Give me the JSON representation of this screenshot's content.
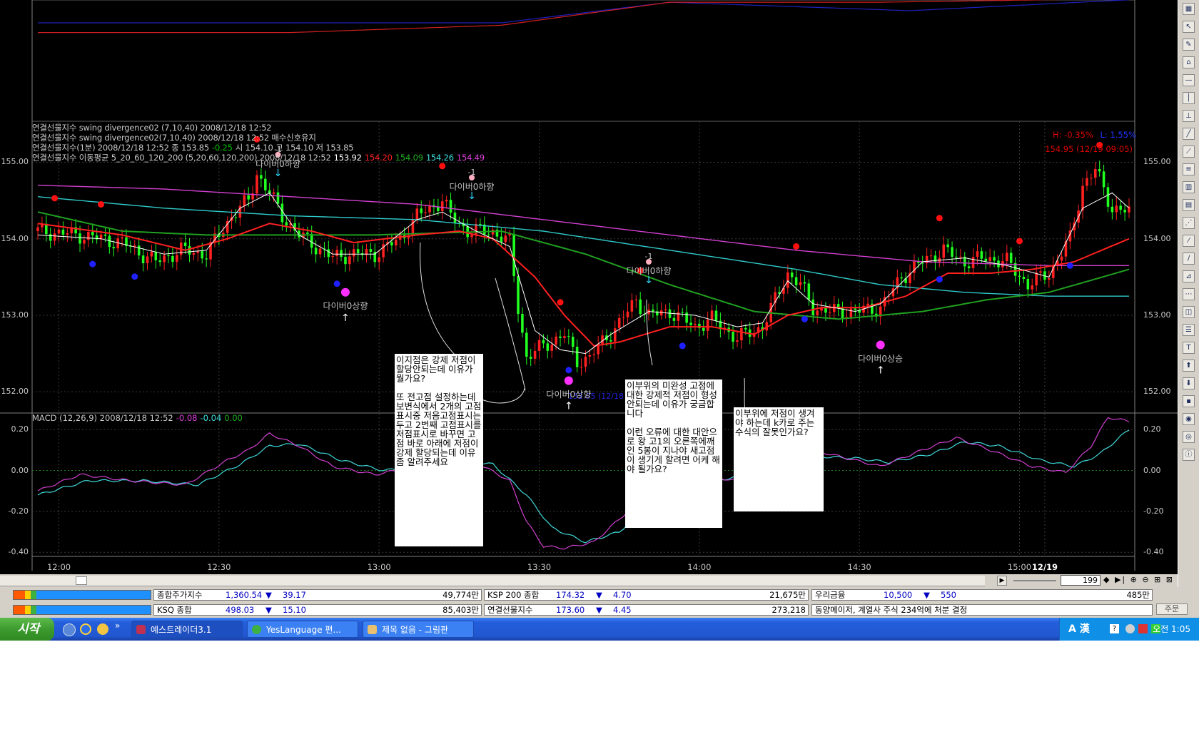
{
  "info_lines": [
    [
      {
        "text": "연결선물지수 swing divergence02  (7,10,40) 2008/12/18 12:52",
        "color": "#c8c8c8"
      }
    ],
    [
      {
        "text": "연결선물지수 swing divergence02(7,10,40)  2008/12/18 12:52  매수신호유지",
        "color": "#c8c8c8"
      }
    ],
    [
      {
        "text": "연결선물지수(1분) 2008/12/18 12:52  종 153.85",
        "color": "#c8c8c8"
      },
      {
        "text": "-0.25",
        "color": "#00c000"
      },
      {
        "text": "시 154.10 고 154.10 저 153.85",
        "color": "#c8c8c8"
      }
    ],
    [
      {
        "text": "연결선물지수 이동평균 5_20_60_120_200  (5,20,60,120,200) 2008/12/18 12:52",
        "color": "#c8c8c8"
      },
      {
        "text": "153.92",
        "color": "#ffffff"
      },
      {
        "text": "154.20",
        "color": "#ff2020"
      },
      {
        "text": "154.09",
        "color": "#20b020"
      },
      {
        "text": "154.26",
        "color": "#40e0e0"
      },
      {
        "text": "154.49",
        "color": "#e040e0"
      }
    ]
  ],
  "hl_line": {
    "h": "H: -0.35%",
    "l": "L: 1.55%"
  },
  "max_label": "154.95 (12/19 09:05)",
  "min_label": "152.05 (12/18",
  "y_labels": [
    "155.00",
    "154.00",
    "153.00",
    "152.00"
  ],
  "macd_y_labels": [
    "0.20",
    "0.00",
    "-0.20",
    "-0.40"
  ],
  "x_labels": [
    "12:00",
    "12:30",
    "13:00",
    "13:30",
    "14:00",
    "14:30",
    "15:00",
    "12/19"
  ],
  "macd_legend": [
    {
      "text": "MACD  (12,26,9) 2008/12/18 12:52",
      "color": "#c8c8c8"
    },
    {
      "text": "-0.08",
      "color": "#e040e0"
    },
    {
      "text": "-0.04",
      "color": "#40e0e0"
    },
    {
      "text": "0.00",
      "color": "#20b020"
    }
  ],
  "signals": [
    {
      "label": "다이버0하향",
      "minus": "-1",
      "t": 57
    },
    {
      "label": "다이버0상향",
      "minus": "",
      "t": 73
    },
    {
      "label": "다이버0하향",
      "minus": "-1",
      "t": 103
    },
    {
      "label": "다이버0상향",
      "minus": "",
      "t": 126
    },
    {
      "label": "다이버0하향",
      "minus": "-1",
      "t": 145
    },
    {
      "label": "다이버0상승",
      "minus": "",
      "t": 200
    }
  ],
  "memos": [
    {
      "paragraphs": [
        "이지점은 강제 저점이 할당안되는데 이유가 뭘가요?",
        "또 전고점 설정하는데 보변식에서 2개의 고점표시중 저음고점표시는 두고 2번째 고점표시를 저점표시로 바꾸면 고점 바로 아래에 저점이 강제 할당되는데 이유좀 알려주세요"
      ]
    },
    {
      "paragraphs": [
        "이부위의 미완성 고점에 대한 강제적 저점이 형성안되는데 이유가 궁금합니다",
        "이런 오류에 대한 대안으로 왕 고1의 오른쪽에깨인 5봉이 지나야 새고점이 생기게 할려면 어케 해야 될가요?"
      ]
    },
    {
      "paragraphs": [
        "이부위에 저점이 생겨야 하는데 k카로 주는 수식의 잘못인가요?"
      ]
    }
  ],
  "zoom_value": "199",
  "ticker_rows": [
    [
      {
        "name": "종합주가지수",
        "value": "1,360.54",
        "dir": "▼",
        "change": "39.17",
        "extra": "49,774만",
        "cls": "dn"
      },
      {
        "name": "KSP 200 종합",
        "value": "174.32",
        "dir": "▼",
        "change": "4.70",
        "extra": "21,675만",
        "cls": "dn"
      },
      {
        "name": "우리금융",
        "value": "10,500",
        "dir": "▼",
        "change": "550",
        "extra": "485만",
        "cls": "dn"
      }
    ],
    [
      {
        "name": "KSQ 종합",
        "value": "498.03",
        "dir": "▼",
        "change": "15.10",
        "extra": "85,403만",
        "cls": "dn"
      },
      {
        "name": "연결선물지수",
        "value": "173.60",
        "dir": "▼",
        "change": "4.45",
        "extra": "273,218",
        "cls": "dn"
      },
      {
        "name": "동양메이저, 계열사 주식 234억에 처분 결정",
        "value": "",
        "dir": "",
        "change": "",
        "extra": "",
        "cls": ""
      }
    ]
  ],
  "ticker_btn": "주문",
  "taskbar": {
    "start": "시작",
    "tasks": [
      "예스트레이더3.1",
      "YesLanguage 편...",
      "제목 없음 - 그림판"
    ],
    "clock": "오전 1:05",
    "ime": "A 漢"
  },
  "chart_data": {
    "type": "candlestick",
    "ylim": [
      151.9,
      155.2
    ],
    "macd_ylim": [
      -0.42,
      0.26
    ],
    "n_bars": 260,
    "x_tick_index": [
      5,
      43,
      81,
      119,
      157,
      195,
      233,
      239
    ],
    "price_keypoints": [
      [
        0,
        154.1
      ],
      [
        10,
        154.05
      ],
      [
        20,
        153.95
      ],
      [
        28,
        153.7
      ],
      [
        34,
        153.85
      ],
      [
        40,
        153.8
      ],
      [
        46,
        154.3
      ],
      [
        50,
        154.5
      ],
      [
        52,
        154.85
      ],
      [
        55,
        154.6
      ],
      [
        58,
        154.3
      ],
      [
        62,
        154.05
      ],
      [
        66,
        153.9
      ],
      [
        70,
        153.75
      ],
      [
        74,
        153.8
      ],
      [
        80,
        153.8
      ],
      [
        86,
        154.0
      ],
      [
        90,
        154.3
      ],
      [
        96,
        154.5
      ],
      [
        98,
        154.3
      ],
      [
        102,
        154.1
      ],
      [
        108,
        154.1
      ],
      [
        112,
        153.95
      ],
      [
        114,
        153.1
      ],
      [
        116,
        152.45
      ],
      [
        120,
        152.6
      ],
      [
        125,
        152.75
      ],
      [
        128,
        152.4
      ],
      [
        131,
        152.45
      ],
      [
        134,
        152.65
      ],
      [
        138,
        152.9
      ],
      [
        142,
        153.2
      ],
      [
        145,
        153.0
      ],
      [
        150,
        153.05
      ],
      [
        156,
        152.85
      ],
      [
        160,
        152.95
      ],
      [
        166,
        152.7
      ],
      [
        172,
        152.85
      ],
      [
        175,
        153.2
      ],
      [
        178,
        153.55
      ],
      [
        181,
        153.4
      ],
      [
        184,
        153.1
      ],
      [
        188,
        153.05
      ],
      [
        194,
        153.05
      ],
      [
        200,
        153.1
      ],
      [
        205,
        153.5
      ],
      [
        210,
        153.7
      ],
      [
        215,
        153.85
      ],
      [
        220,
        153.7
      ],
      [
        225,
        153.75
      ],
      [
        230,
        153.7
      ],
      [
        235,
        153.4
      ],
      [
        240,
        153.55
      ],
      [
        245,
        154.0
      ],
      [
        248,
        154.7
      ],
      [
        251,
        154.9
      ],
      [
        255,
        154.4
      ],
      [
        259,
        154.35
      ]
    ],
    "ma_white": [
      [
        0,
        154.05
      ],
      [
        15,
        154.0
      ],
      [
        30,
        153.8
      ],
      [
        40,
        153.85
      ],
      [
        48,
        154.4
      ],
      [
        55,
        154.6
      ],
      [
        62,
        154.05
      ],
      [
        70,
        153.8
      ],
      [
        80,
        153.8
      ],
      [
        90,
        154.25
      ],
      [
        96,
        154.35
      ],
      [
        104,
        154.1
      ],
      [
        112,
        153.9
      ],
      [
        118,
        152.8
      ],
      [
        124,
        152.55
      ],
      [
        130,
        152.5
      ],
      [
        136,
        152.75
      ],
      [
        145,
        153.05
      ],
      [
        156,
        153.0
      ],
      [
        166,
        152.85
      ],
      [
        172,
        152.9
      ],
      [
        178,
        153.45
      ],
      [
        184,
        153.15
      ],
      [
        194,
        153.05
      ],
      [
        200,
        153.15
      ],
      [
        210,
        153.7
      ],
      [
        220,
        153.75
      ],
      [
        230,
        153.65
      ],
      [
        240,
        153.5
      ],
      [
        248,
        154.4
      ],
      [
        255,
        154.6
      ],
      [
        259,
        154.4
      ]
    ],
    "ma_red": [
      [
        0,
        154.2
      ],
      [
        20,
        154.05
      ],
      [
        35,
        153.85
      ],
      [
        45,
        154.0
      ],
      [
        55,
        154.2
      ],
      [
        65,
        154.1
      ],
      [
        75,
        153.95
      ],
      [
        90,
        154.05
      ],
      [
        100,
        154.1
      ],
      [
        108,
        154.0
      ],
      [
        118,
        153.5
      ],
      [
        125,
        153.0
      ],
      [
        132,
        152.6
      ],
      [
        138,
        152.65
      ],
      [
        150,
        152.85
      ],
      [
        160,
        152.85
      ],
      [
        170,
        152.75
      ],
      [
        178,
        153.0
      ],
      [
        186,
        153.1
      ],
      [
        196,
        153.1
      ],
      [
        206,
        153.25
      ],
      [
        216,
        153.55
      ],
      [
        226,
        153.55
      ],
      [
        236,
        153.6
      ],
      [
        246,
        153.7
      ],
      [
        259,
        154.0
      ]
    ],
    "ma_green": [
      [
        0,
        154.35
      ],
      [
        20,
        154.1
      ],
      [
        40,
        154.05
      ],
      [
        60,
        154.05
      ],
      [
        80,
        154.05
      ],
      [
        110,
        154.1
      ],
      [
        130,
        153.8
      ],
      [
        150,
        153.4
      ],
      [
        170,
        153.05
      ],
      [
        190,
        152.95
      ],
      [
        210,
        153.05
      ],
      [
        225,
        153.2
      ],
      [
        240,
        153.3
      ],
      [
        259,
        153.6
      ]
    ],
    "ma_cyan": [
      [
        0,
        154.55
      ],
      [
        30,
        154.4
      ],
      [
        60,
        154.3
      ],
      [
        90,
        154.25
      ],
      [
        120,
        154.1
      ],
      [
        150,
        153.85
      ],
      [
        180,
        153.6
      ],
      [
        200,
        153.4
      ],
      [
        220,
        153.3
      ],
      [
        240,
        153.25
      ],
      [
        259,
        153.25
      ]
    ],
    "ma_magenta": [
      [
        0,
        154.7
      ],
      [
        30,
        154.65
      ],
      [
        60,
        154.55
      ],
      [
        90,
        154.45
      ],
      [
        120,
        154.25
      ],
      [
        150,
        154.05
      ],
      [
        180,
        153.85
      ],
      [
        210,
        153.7
      ],
      [
        240,
        153.65
      ],
      [
        259,
        153.65
      ]
    ],
    "top_line_red": [
      [
        0,
        0.72
      ],
      [
        60,
        0.72
      ],
      [
        110,
        0.78
      ],
      [
        150,
        0.97
      ],
      [
        200,
        0.97
      ],
      [
        259,
        1.0
      ]
    ],
    "top_line_blue": [
      [
        0,
        0.8
      ],
      [
        65,
        0.8
      ],
      [
        110,
        0.8
      ],
      [
        150,
        0.97
      ],
      [
        207,
        0.9
      ],
      [
        259,
        0.99
      ]
    ],
    "macd_line": [
      [
        0,
        -0.1
      ],
      [
        10,
        -0.02
      ],
      [
        22,
        -0.05
      ],
      [
        35,
        -0.07
      ],
      [
        45,
        0.05
      ],
      [
        50,
        0.1
      ],
      [
        55,
        0.18
      ],
      [
        62,
        0.12
      ],
      [
        70,
        0.02
      ],
      [
        80,
        -0.02
      ],
      [
        90,
        0.02
      ],
      [
        98,
        0.07
      ],
      [
        104,
        0.04
      ],
      [
        112,
        -0.05
      ],
      [
        116,
        -0.25
      ],
      [
        120,
        -0.37
      ],
      [
        125,
        -0.38
      ],
      [
        132,
        -0.35
      ],
      [
        140,
        -0.2
      ],
      [
        148,
        -0.05
      ],
      [
        156,
        -0.02
      ],
      [
        166,
        -0.05
      ],
      [
        176,
        0.03
      ],
      [
        184,
        0.1
      ],
      [
        194,
        0.05
      ],
      [
        200,
        0.02
      ],
      [
        210,
        0.1
      ],
      [
        218,
        0.16
      ],
      [
        226,
        0.1
      ],
      [
        236,
        0.02
      ],
      [
        244,
        -0.01
      ],
      [
        250,
        0.12
      ],
      [
        254,
        0.26
      ],
      [
        259,
        0.24
      ]
    ],
    "signal_line": [
      [
        0,
        -0.12
      ],
      [
        12,
        -0.05
      ],
      [
        25,
        -0.05
      ],
      [
        38,
        -0.07
      ],
      [
        48,
        0.03
      ],
      [
        55,
        0.12
      ],
      [
        62,
        0.13
      ],
      [
        72,
        0.05
      ],
      [
        82,
        0.0
      ],
      [
        92,
        0.02
      ],
      [
        100,
        0.05
      ],
      [
        108,
        0.03
      ],
      [
        116,
        -0.12
      ],
      [
        122,
        -0.28
      ],
      [
        130,
        -0.35
      ],
      [
        138,
        -0.3
      ],
      [
        146,
        -0.15
      ],
      [
        154,
        -0.05
      ],
      [
        164,
        -0.04
      ],
      [
        174,
        0.0
      ],
      [
        184,
        0.07
      ],
      [
        194,
        0.06
      ],
      [
        202,
        0.04
      ],
      [
        212,
        0.08
      ],
      [
        220,
        0.14
      ],
      [
        228,
        0.12
      ],
      [
        238,
        0.05
      ],
      [
        246,
        0.02
      ],
      [
        252,
        0.08
      ],
      [
        259,
        0.2
      ]
    ],
    "peak_markers": [
      4,
      15,
      52,
      96,
      124,
      143,
      180,
      214,
      233,
      252
    ],
    "trough_markers": [
      13,
      23,
      71,
      126,
      153,
      182,
      214,
      245
    ]
  }
}
